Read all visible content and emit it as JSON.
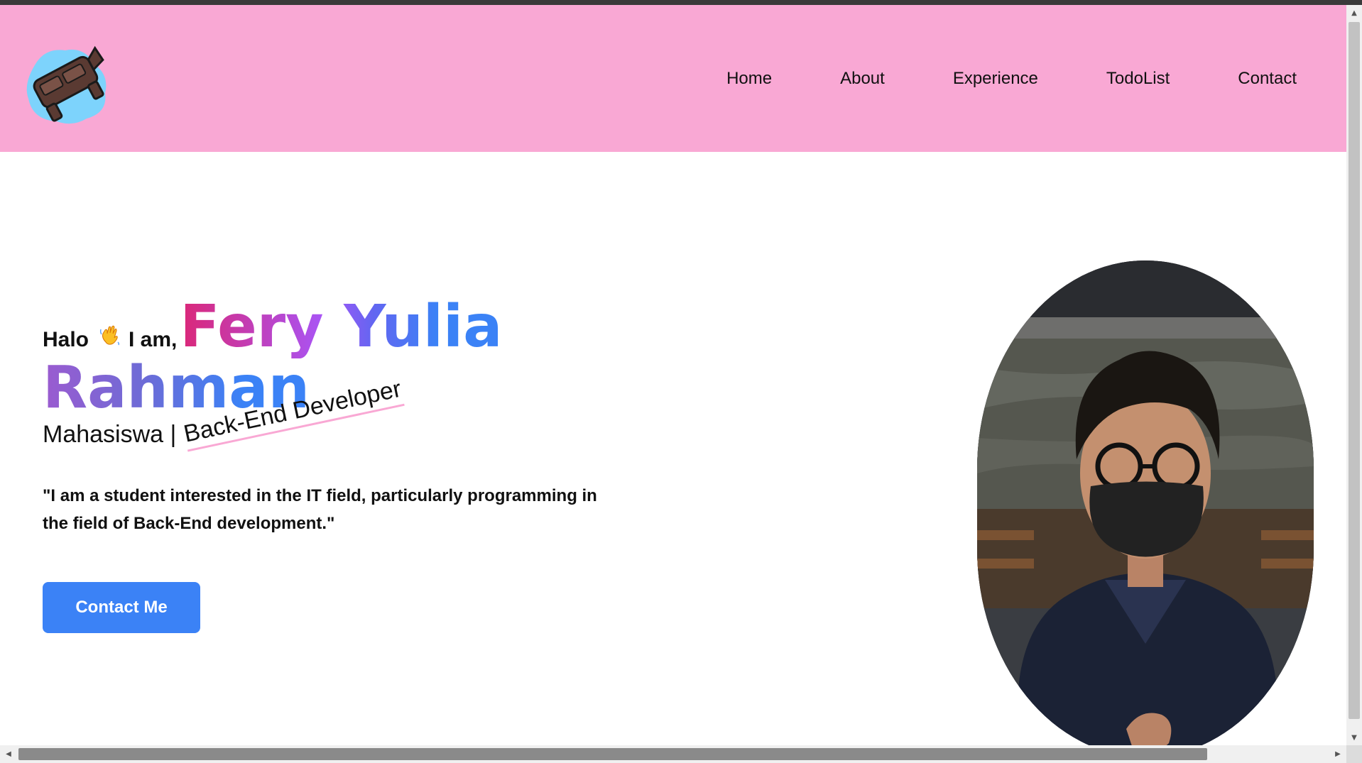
{
  "navbar": {
    "logo_alt": "Fery logo",
    "links": [
      {
        "label": "Home"
      },
      {
        "label": "About"
      },
      {
        "label": "Experience"
      },
      {
        "label": "TodoList"
      },
      {
        "label": "Contact"
      }
    ],
    "background": "#f9a8d4"
  },
  "hero": {
    "greeting": "Halo",
    "greeting_icon": "waving-hand-icon",
    "intro": "I am,",
    "name_first": "Fery Yulia",
    "name_second": "Rahman",
    "role_static": "Mahasiswa |",
    "role_rotating": "Back-End Developer",
    "quote": "\"I am a student interested in the IT field, particularly programming in the field of Back-End development.\"",
    "cta_label": "Contact Me"
  },
  "colors": {
    "accent": "#3b82f6",
    "name_gradient_start": "#db2777",
    "name_gradient_mid": "#a855f7",
    "name_gradient_end": "#3b82f6",
    "navbar": "#f9a8d4"
  }
}
